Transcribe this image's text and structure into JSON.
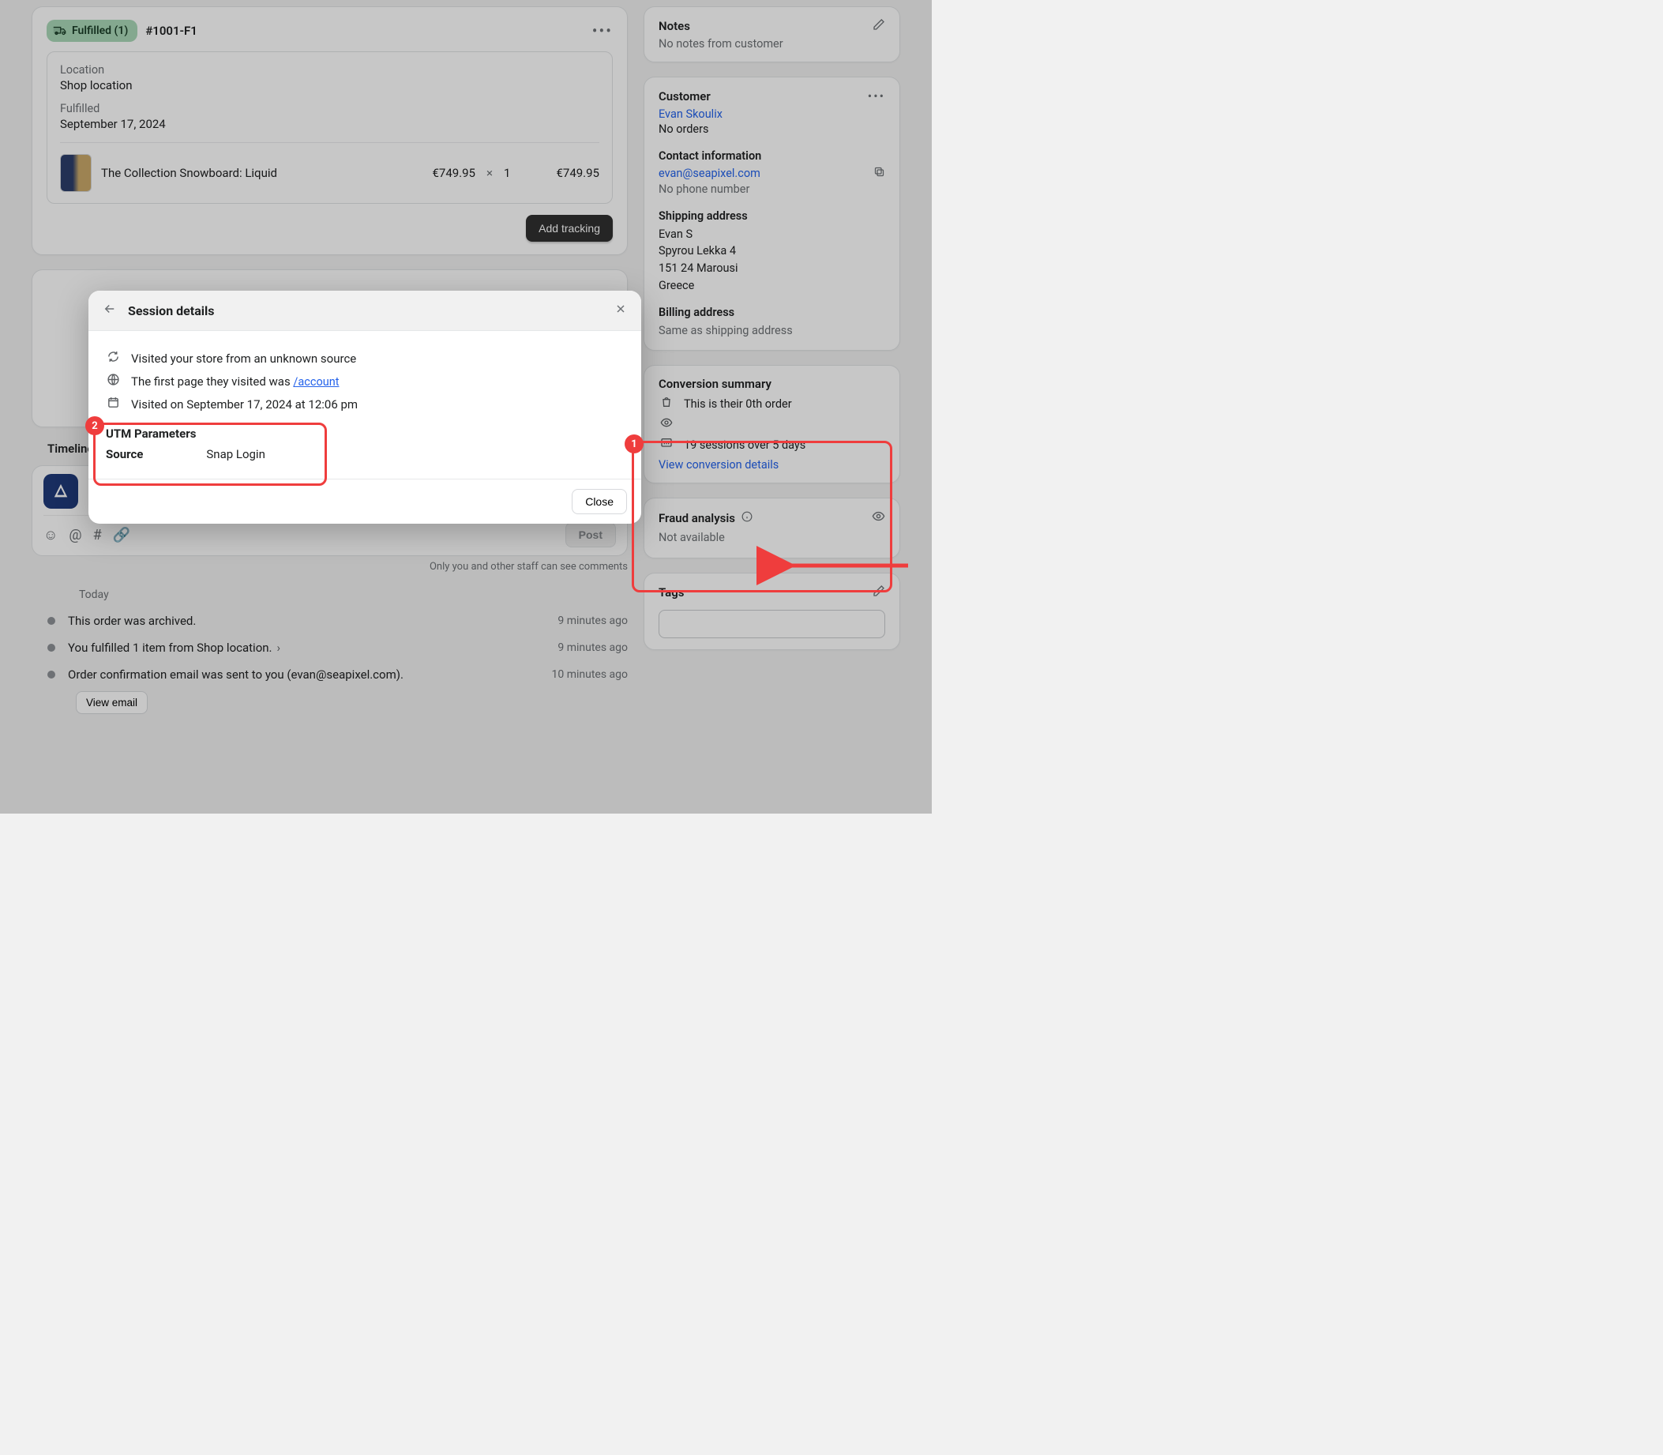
{
  "fulfillment": {
    "badge": "Fulfilled (1)",
    "orderRef": "#1001-F1",
    "locationLabel": "Location",
    "locationValue": "Shop location",
    "fulfilledLabel": "Fulfilled",
    "fulfilledDate": "September 17, 2024",
    "productName": "The Collection Snowboard: Liquid",
    "unitPrice": "€749.95",
    "qtySep": "×",
    "qty": "1",
    "lineTotal": "€749.95",
    "addTracking": "Add tracking"
  },
  "timeline": {
    "title": "Timeline",
    "postBtn": "Post",
    "staffNote": "Only you and other staff can see comments",
    "dayLabel": "Today",
    "events": [
      {
        "text": "This order was archived.",
        "time": "9 minutes ago",
        "chevron": false
      },
      {
        "text": "You fulfilled 1 item from Shop location.",
        "time": "9 minutes ago",
        "chevron": true
      },
      {
        "text": "Order confirmation email was sent to you (evan@seapixel.com).",
        "time": "10 minutes ago",
        "chevron": false
      }
    ],
    "viewEmail": "View email"
  },
  "sidebar": {
    "notes": {
      "title": "Notes",
      "empty": "No notes from customer"
    },
    "customer": {
      "title": "Customer",
      "name": "Evan Skoulix",
      "orders": "No orders",
      "contactLabel": "Contact information",
      "email": "evan@seapixel.com",
      "phone": "No phone number",
      "shippingLabel": "Shipping address",
      "shippingLines": [
        "Evan S",
        "Spyrou Lekka 4",
        "151 24 Marousi",
        "Greece"
      ],
      "billingLabel": "Billing address",
      "billingSame": "Same as shipping address"
    },
    "conversion": {
      "title": "Conversion summary",
      "orderStat": "This is their 0th order",
      "sessions": "19 sessions over 5 days",
      "viewLink": "View conversion details"
    },
    "fraud": {
      "title": "Fraud analysis",
      "status": "Not available"
    },
    "tags": {
      "title": "Tags"
    }
  },
  "modal": {
    "title": "Session details",
    "sourceLine": "Visited your store from an unknown source",
    "firstPagePrefix": "The first page they visited was ",
    "firstPageLink": "/account",
    "visitedOn": "Visited on September 17, 2024 at 12:06 pm",
    "utmTitle": "UTM Parameters",
    "utmSourceKey": "Source",
    "utmSourceVal": "Snap Login",
    "closeBtn": "Close"
  },
  "annotations": {
    "badge1": "1",
    "badge2": "2"
  }
}
